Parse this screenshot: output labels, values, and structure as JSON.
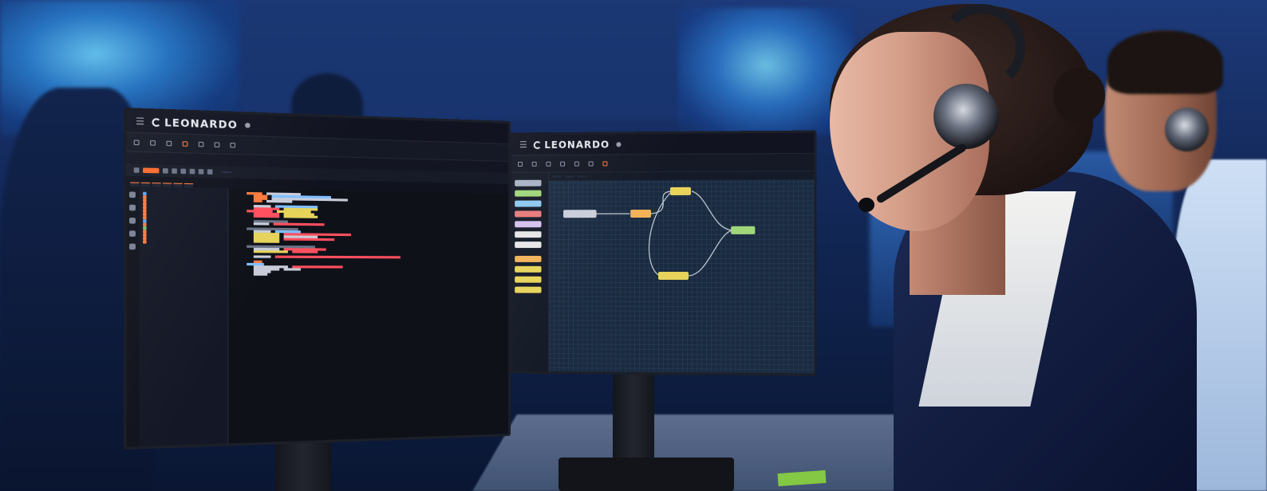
{
  "left_monitor": {
    "brand": "LEONARDO",
    "user_line1": "",
    "user_line2": "",
    "nav_tabs": [
      {
        "label": "",
        "active": false
      },
      {
        "label": "",
        "active": false
      },
      {
        "label": "",
        "active": false
      },
      {
        "label": "",
        "active": true
      },
      {
        "label": "",
        "active": false
      },
      {
        "label": "",
        "active": false
      },
      {
        "label": "",
        "active": false
      }
    ],
    "menu_items": [
      "",
      "",
      "",
      "",
      "",
      "",
      "",
      "",
      ""
    ],
    "kernel_label": "",
    "doc_tabs": [
      "",
      "",
      "",
      "",
      "",
      ""
    ],
    "file_panel_header": {
      "name_col": "",
      "modified_col": ""
    },
    "files": [
      {
        "name": "",
        "date": "",
        "kind": "b"
      },
      {
        "name": "",
        "date": "",
        "kind": "o"
      },
      {
        "name": "",
        "date": "",
        "kind": "o"
      },
      {
        "name": "",
        "date": "",
        "kind": "o"
      },
      {
        "name": "",
        "date": "",
        "kind": "o"
      },
      {
        "name": "",
        "date": "",
        "kind": "o"
      },
      {
        "name": "",
        "date": "",
        "kind": "o"
      },
      {
        "name": "",
        "date": "",
        "kind": "o"
      },
      {
        "name": "",
        "date": "",
        "kind": "b"
      },
      {
        "name": "",
        "date": "",
        "kind": "o"
      },
      {
        "name": "",
        "date": "",
        "kind": "g"
      },
      {
        "name": "",
        "date": "",
        "kind": "o"
      },
      {
        "name": "",
        "date": "",
        "kind": "o"
      },
      {
        "name": "",
        "date": "",
        "kind": "o"
      },
      {
        "name": "",
        "date": "",
        "kind": "o"
      }
    ],
    "accent_color": "#ff7a3c"
  },
  "right_monitor": {
    "brand": "LEONARDO",
    "user_line1": "",
    "user_line2": "",
    "nav_tabs": [
      {
        "label": "",
        "active": false
      },
      {
        "label": "",
        "active": false
      },
      {
        "label": "",
        "active": false
      },
      {
        "label": "",
        "active": false
      },
      {
        "label": "",
        "active": false
      },
      {
        "label": "",
        "active": false
      },
      {
        "label": "",
        "active": true
      }
    ],
    "flow_tabs": [
      {
        "label": "",
        "active": true
      },
      {
        "label": "",
        "active": false
      },
      {
        "label": "",
        "active": false
      }
    ],
    "palette_sections": [
      "",
      ""
    ],
    "palette_colors": [
      "#a9b3c6",
      "#9fd67a",
      "#8fc7f0",
      "#e87b7b",
      "#d6c1f0",
      "#e6e6e6",
      "#e6e6e6",
      "#f2b35a",
      "#e8d45a",
      "#e8d45a",
      "#e8d45a"
    ],
    "node_colors": [
      "#c9ced8",
      "#f2b35a",
      "#e8d45a",
      "#9fd67a",
      "#e8d45a"
    ],
    "grid_color": "#1a2a3f"
  }
}
